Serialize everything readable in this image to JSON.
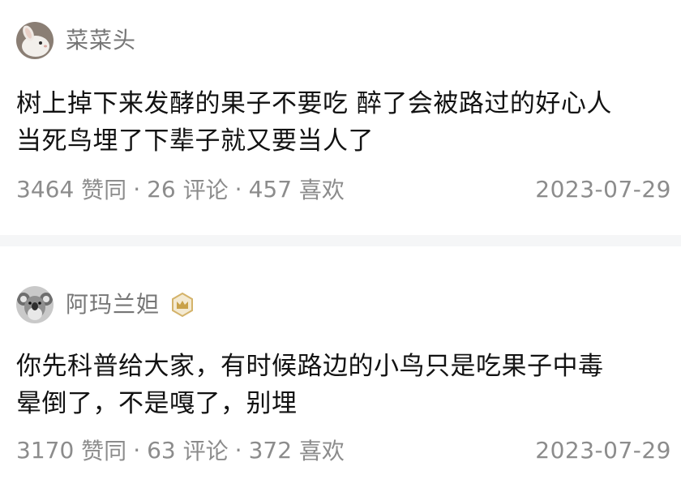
{
  "posts": [
    {
      "author": "菜菜头",
      "content": "树上掉下来发酵的果子不要吃 醉了会被路过的好心人\n当死鸟埋了下辈子就又要当人了",
      "likes": "3464",
      "likes_label": "赞同",
      "comments": "26",
      "comments_label": "评论",
      "favorites": "457",
      "favorites_label": "喜欢",
      "date": "2023-07-29",
      "avatar_icon": "rabbit-avatar"
    },
    {
      "author": "阿玛兰妲",
      "content": "你先科普给大家，有时候路边的小鸟只是吃果子中毒\n晕倒了，不是嘎了，别埋",
      "likes": "3170",
      "likes_label": "赞同",
      "comments": "63",
      "comments_label": "评论",
      "favorites": "372",
      "favorites_label": "喜欢",
      "date": "2023-07-29",
      "avatar_icon": "koala-avatar",
      "badge_icon": "crown-badge-icon"
    }
  ],
  "separator": "·",
  "colors": {
    "meta_text": "#8c8c8c",
    "author_text": "#767676",
    "body_text": "#121212",
    "divider": "#f5f6f7",
    "badge_gold": "#c9a24a"
  }
}
